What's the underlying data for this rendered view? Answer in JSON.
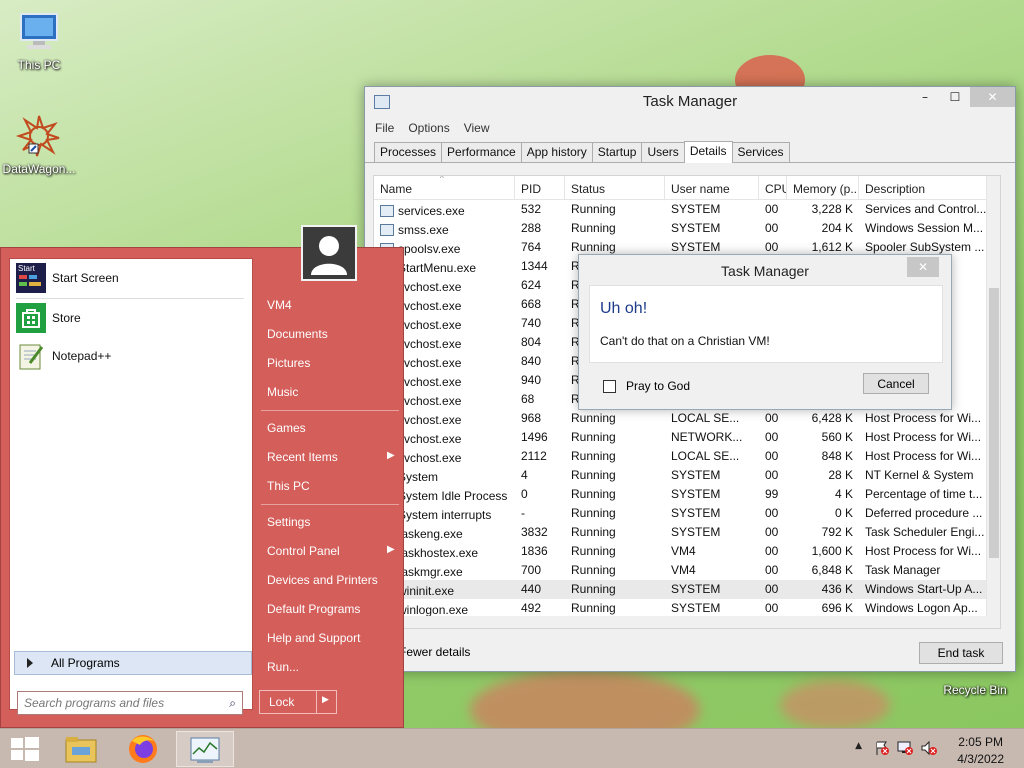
{
  "desktop": {
    "icons": [
      {
        "label": "This PC"
      },
      {
        "label": "DataWagon..."
      },
      {
        "label": "Recycle Bin"
      }
    ]
  },
  "task_manager": {
    "title": "Task Manager",
    "window_buttons": {
      "minimize": "–",
      "maximize": "☐",
      "close": "✕"
    },
    "menu": [
      "File",
      "Options",
      "View"
    ],
    "tabs": [
      "Processes",
      "Performance",
      "App history",
      "Startup",
      "Users",
      "Details",
      "Services"
    ],
    "active_tab": "Details",
    "columns": [
      "Name",
      "PID",
      "Status",
      "User name",
      "CPU",
      "Memory (p...",
      "Description"
    ],
    "rows": [
      {
        "name": "services.exe",
        "pid": "532",
        "status": "Running",
        "user": "SYSTEM",
        "cpu": "00",
        "mem": "3,228 K",
        "desc": "Services and Control..."
      },
      {
        "name": "smss.exe",
        "pid": "288",
        "status": "Running",
        "user": "SYSTEM",
        "cpu": "00",
        "mem": "204 K",
        "desc": "Windows Session M..."
      },
      {
        "name": "spoolsv.exe",
        "pid": "764",
        "status": "Running",
        "user": "SYSTEM",
        "cpu": "00",
        "mem": "1,612 K",
        "desc": "Spooler SubSystem ..."
      },
      {
        "name": "StartMenu.exe",
        "pid": "1344",
        "status": "R",
        "user": "",
        "cpu": "",
        "mem": "",
        "desc": "enu"
      },
      {
        "name": "svchost.exe",
        "pid": "624",
        "status": "R",
        "user": "",
        "cpu": "",
        "mem": "",
        "desc": "r Wi..."
      },
      {
        "name": "svchost.exe",
        "pid": "668",
        "status": "R",
        "user": "",
        "cpu": "",
        "mem": "",
        "desc": "r Wi..."
      },
      {
        "name": "svchost.exe",
        "pid": "740",
        "status": "R",
        "user": "",
        "cpu": "",
        "mem": "",
        "desc": "r Wi..."
      },
      {
        "name": "svchost.exe",
        "pid": "804",
        "status": "R",
        "user": "",
        "cpu": "",
        "mem": "",
        "desc": "r Wi..."
      },
      {
        "name": "svchost.exe",
        "pid": "840",
        "status": "R",
        "user": "",
        "cpu": "",
        "mem": "",
        "desc": "r Wi..."
      },
      {
        "name": "svchost.exe",
        "pid": "940",
        "status": "R",
        "user": "",
        "cpu": "",
        "mem": "",
        "desc": "r Wi..."
      },
      {
        "name": "svchost.exe",
        "pid": "68",
        "status": "R",
        "user": "",
        "cpu": "",
        "mem": "",
        "desc": "r Wi..."
      },
      {
        "name": "svchost.exe",
        "pid": "968",
        "status": "Running",
        "user": "LOCAL SE...",
        "cpu": "00",
        "mem": "6,428 K",
        "desc": "Host Process for Wi..."
      },
      {
        "name": "svchost.exe",
        "pid": "1496",
        "status": "Running",
        "user": "NETWORK...",
        "cpu": "00",
        "mem": "560 K",
        "desc": "Host Process for Wi..."
      },
      {
        "name": "svchost.exe",
        "pid": "2112",
        "status": "Running",
        "user": "LOCAL SE...",
        "cpu": "00",
        "mem": "848 K",
        "desc": "Host Process for Wi..."
      },
      {
        "name": "System",
        "pid": "4",
        "status": "Running",
        "user": "SYSTEM",
        "cpu": "00",
        "mem": "28 K",
        "desc": "NT Kernel & System"
      },
      {
        "name": "System Idle Process",
        "pid": "0",
        "status": "Running",
        "user": "SYSTEM",
        "cpu": "99",
        "mem": "4 K",
        "desc": "Percentage of time t..."
      },
      {
        "name": "System interrupts",
        "pid": "-",
        "status": "Running",
        "user": "SYSTEM",
        "cpu": "00",
        "mem": "0 K",
        "desc": "Deferred procedure ..."
      },
      {
        "name": "taskeng.exe",
        "pid": "3832",
        "status": "Running",
        "user": "SYSTEM",
        "cpu": "00",
        "mem": "792 K",
        "desc": "Task Scheduler Engi..."
      },
      {
        "name": "taskhostex.exe",
        "pid": "1836",
        "status": "Running",
        "user": "VM4",
        "cpu": "00",
        "mem": "1,600 K",
        "desc": "Host Process for Wi..."
      },
      {
        "name": "taskmgr.exe",
        "pid": "700",
        "status": "Running",
        "user": "VM4",
        "cpu": "00",
        "mem": "6,848 K",
        "desc": "Task Manager"
      },
      {
        "name": "wininit.exe",
        "pid": "440",
        "status": "Running",
        "user": "SYSTEM",
        "cpu": "00",
        "mem": "436 K",
        "desc": "Windows Start-Up A..."
      },
      {
        "name": "winlogon.exe",
        "pid": "492",
        "status": "Running",
        "user": "SYSTEM",
        "cpu": "00",
        "mem": "696 K",
        "desc": "Windows Logon Ap..."
      }
    ],
    "selected_row": "wininit.exe",
    "fewer_details": "Fewer details",
    "end_task": "End task"
  },
  "dialog": {
    "title": "Task Manager",
    "close": "✕",
    "heading": "Uh oh!",
    "message": "Can't do that on a Christian VM!",
    "checkbox_label": "Pray to God",
    "checkbox_checked": false,
    "cancel": "Cancel"
  },
  "start_menu": {
    "pinned": [
      {
        "label": "Start Screen",
        "icon": "start-screen-icon"
      },
      {
        "label": "Store",
        "icon": "store-icon"
      },
      {
        "label": "Notepad++",
        "icon": "notepadpp-icon"
      }
    ],
    "all_programs": "All Programs",
    "search_placeholder": "Search programs and files",
    "right_items": [
      {
        "label": "VM4"
      },
      {
        "label": "Documents"
      },
      {
        "label": "Pictures"
      },
      {
        "label": "Music"
      },
      {
        "label": "Games"
      },
      {
        "label": "Recent Items",
        "submenu": true
      },
      {
        "label": "This PC"
      },
      {
        "label": "Settings"
      },
      {
        "label": "Control Panel",
        "submenu": true
      },
      {
        "label": "Devices and Printers"
      },
      {
        "label": "Default Programs"
      },
      {
        "label": "Help and Support"
      },
      {
        "label": "Run..."
      }
    ],
    "lock": "Lock",
    "start_tile_text": "Start"
  },
  "taskbar": {
    "clock_time": "2:05 PM",
    "clock_date": "4/3/2022",
    "tray_up": "▲",
    "colors": {
      "bar": "#c7b8b0",
      "start_menu": "#d45e5a"
    }
  }
}
